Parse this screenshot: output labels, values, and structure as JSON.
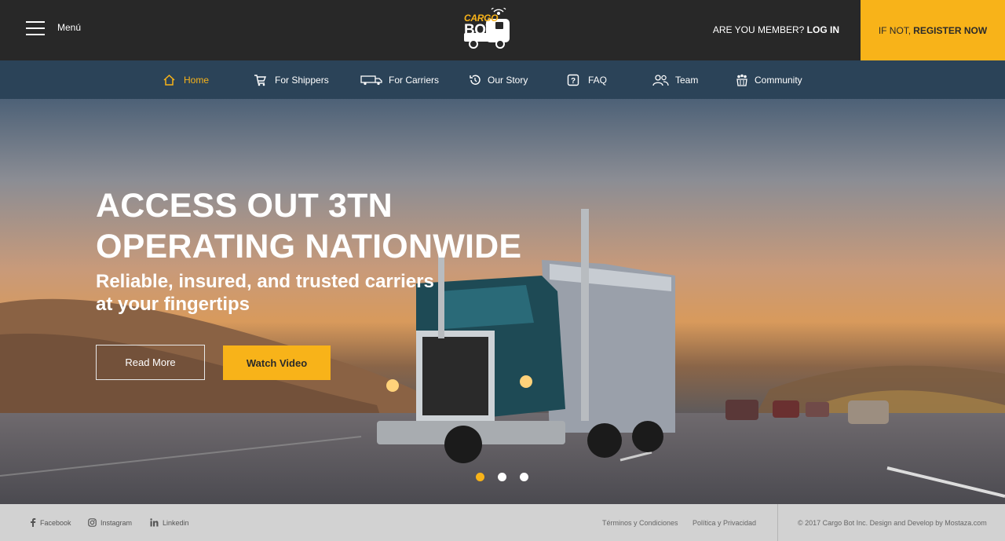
{
  "header": {
    "menu_label": "Menú",
    "logo_line1": "CARGO",
    "logo_line2": "BOT",
    "member_prefix": "ARE YOU MEMBER?",
    "login_label": "LOG IN",
    "register_prefix": "IF NOT,",
    "register_label": "REGISTER NOW"
  },
  "nav": [
    {
      "label": "Home",
      "icon": "home-icon",
      "active": true
    },
    {
      "label": "For Shippers",
      "icon": "cart-icon",
      "active": false
    },
    {
      "label": "For Carriers",
      "icon": "truck-icon",
      "active": false
    },
    {
      "label": "Our Story",
      "icon": "history-icon",
      "active": false
    },
    {
      "label": "FAQ",
      "icon": "question-icon",
      "active": false
    },
    {
      "label": "Team",
      "icon": "team-icon",
      "active": false
    },
    {
      "label": "Community",
      "icon": "community-icon",
      "active": false
    }
  ],
  "hero": {
    "headline_line1": "ACCESS OUT 3TN",
    "headline_line2": "OPERATING NATIONWIDE",
    "sub_line1": "Reliable, insured, and trusted carriers",
    "sub_line2": "at your fingertips",
    "read_more_label": "Read More",
    "watch_video_label": "Watch Video",
    "slides_total": 3,
    "active_slide": 1
  },
  "footer": {
    "social": [
      {
        "label": "Facebook",
        "icon": "facebook-icon"
      },
      {
        "label": "Instagram",
        "icon": "instagram-icon"
      },
      {
        "label": "Linkedin",
        "icon": "linkedin-icon"
      }
    ],
    "terms_label": "Términos y Condiciones",
    "privacy_label": "Política y Privacidad",
    "copyright": "© 2017 Cargo Bot Inc. Design and Develop by Mostaza.com"
  },
  "colors": {
    "accent": "#f8b319",
    "header_bg": "#282828",
    "nav_bg": "#2b4358",
    "footer_bg": "#d2d2d2"
  }
}
